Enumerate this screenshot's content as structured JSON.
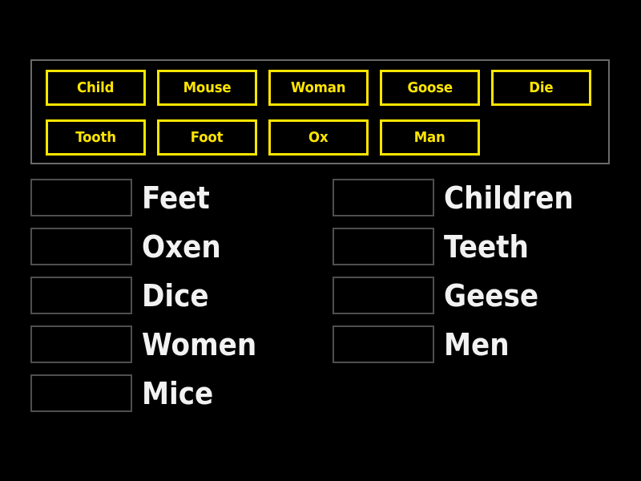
{
  "page": {
    "background_color": "#000000",
    "tile_color": "#ffe500",
    "label_color": "#f2f2f2",
    "slot_border_color": "#4f4f4f",
    "bank_border_color": "#6a6a6a"
  },
  "word_bank": {
    "rows": [
      {
        "tiles": [
          {
            "label": "Child"
          },
          {
            "label": "Mouse"
          },
          {
            "label": "Woman"
          },
          {
            "label": "Goose"
          },
          {
            "label": "Die"
          }
        ]
      },
      {
        "tiles": [
          {
            "label": "Tooth"
          },
          {
            "label": "Foot"
          },
          {
            "label": "Ox"
          },
          {
            "label": "Man"
          }
        ]
      }
    ]
  },
  "answers": {
    "left_column": [
      {
        "slot_value": "",
        "label": "Feet"
      },
      {
        "slot_value": "",
        "label": "Oxen"
      },
      {
        "slot_value": "",
        "label": "Dice"
      },
      {
        "slot_value": "",
        "label": "Women"
      },
      {
        "slot_value": "",
        "label": "Mice"
      }
    ],
    "right_column": [
      {
        "slot_value": "",
        "label": "Children"
      },
      {
        "slot_value": "",
        "label": "Teeth"
      },
      {
        "slot_value": "",
        "label": "Geese"
      },
      {
        "slot_value": "",
        "label": "Men"
      }
    ]
  }
}
